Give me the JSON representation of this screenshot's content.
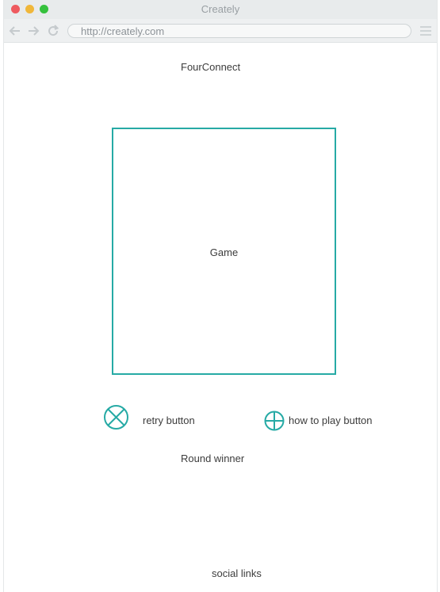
{
  "window": {
    "title": "Creately"
  },
  "browser": {
    "url": "http://creately.com",
    "icons": [
      "back-arrow-icon",
      "forward-arrow-icon",
      "reload-icon",
      "hamburger-menu-icon"
    ]
  },
  "page": {
    "app_title": "FourConnect",
    "game_label": "Game",
    "retry_label": "retry button",
    "how_to_play_label": "how to play button",
    "round_winner_label": "Round winner",
    "social_links_label": "social links"
  },
  "colors": {
    "accent": "#26aaa5",
    "titlebar": "#e8ebec",
    "close": "#ee5a5f",
    "minimize": "#f0b73a",
    "maximize": "#35c13d"
  },
  "icons": {
    "retry": "circle-x-icon",
    "how_to_play": "circle-plus-icon"
  }
}
